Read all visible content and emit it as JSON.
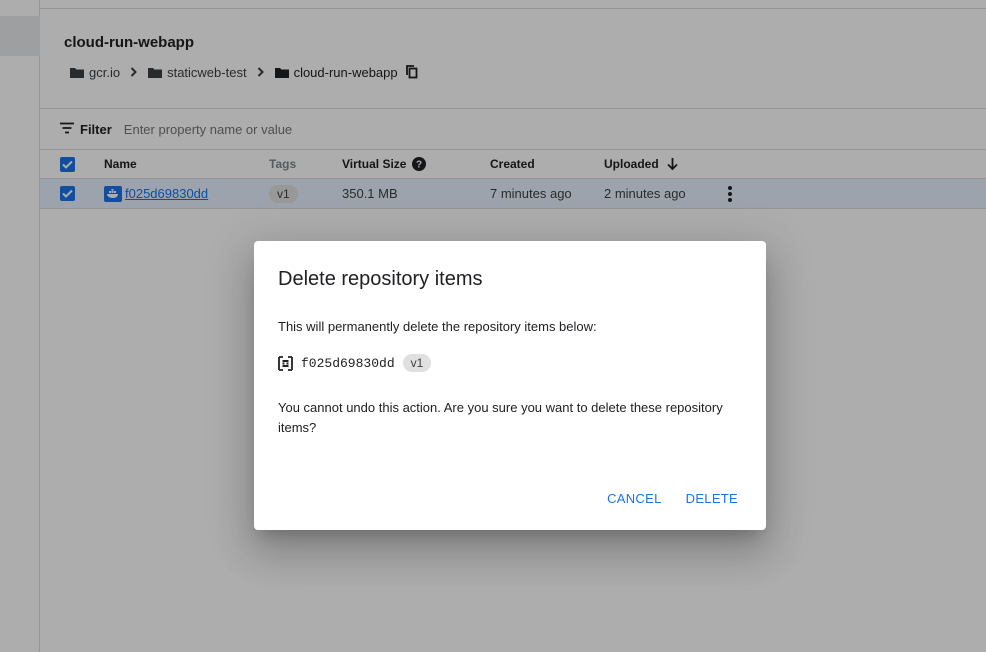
{
  "page": {
    "title": "cloud-run-webapp",
    "breadcrumb": [
      "gcr.io",
      "staticweb-test",
      "cloud-run-webapp"
    ]
  },
  "filter": {
    "label": "Filter",
    "placeholder": "Enter property name or value"
  },
  "table": {
    "columns": {
      "name": "Name",
      "tags": "Tags",
      "virtual_size": "Virtual Size",
      "created": "Created",
      "uploaded": "Uploaded"
    },
    "rows": [
      {
        "name": "f025d69830dd",
        "tag": "v1",
        "virtual_size": "350.1 MB",
        "created": "7 minutes ago",
        "uploaded": "2 minutes ago",
        "selected": true
      }
    ]
  },
  "dialog": {
    "title": "Delete repository items",
    "body1": "This will permanently delete the repository items below:",
    "item_digest": "f025d69830dd",
    "item_tag": "v1",
    "body2": "You cannot undo this action. Are you sure you want to delete these repository items?",
    "cancel_label": "CANCEL",
    "delete_label": "DELETE"
  },
  "colors": {
    "accent": "#1a73e8",
    "selected_row": "#e8f0fe",
    "scrim": "rgba(0,0,0,0.32)"
  },
  "icons": {
    "folder": "folder-icon",
    "chevron": "chevron-right-icon",
    "copy": "copy-icon",
    "filter": "filter-icon",
    "help": "help-icon",
    "sort": "arrow-down-icon",
    "more": "more-vert-icon",
    "docker": "docker-icon",
    "digest": "digest-icon"
  }
}
